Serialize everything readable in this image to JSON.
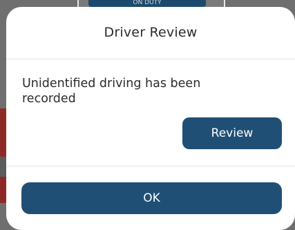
{
  "background": {
    "top_button_label": "ON DUTY"
  },
  "dialog": {
    "title": "Driver Review",
    "message": "Unidentified driving has been recorded",
    "review_label": "Review",
    "ok_label": "OK"
  },
  "colors": {
    "primary": "#1f4f75",
    "dialog_bg": "#ffffff",
    "backdrop": "#6f6f6f",
    "accent_red": "#8e2a25"
  }
}
